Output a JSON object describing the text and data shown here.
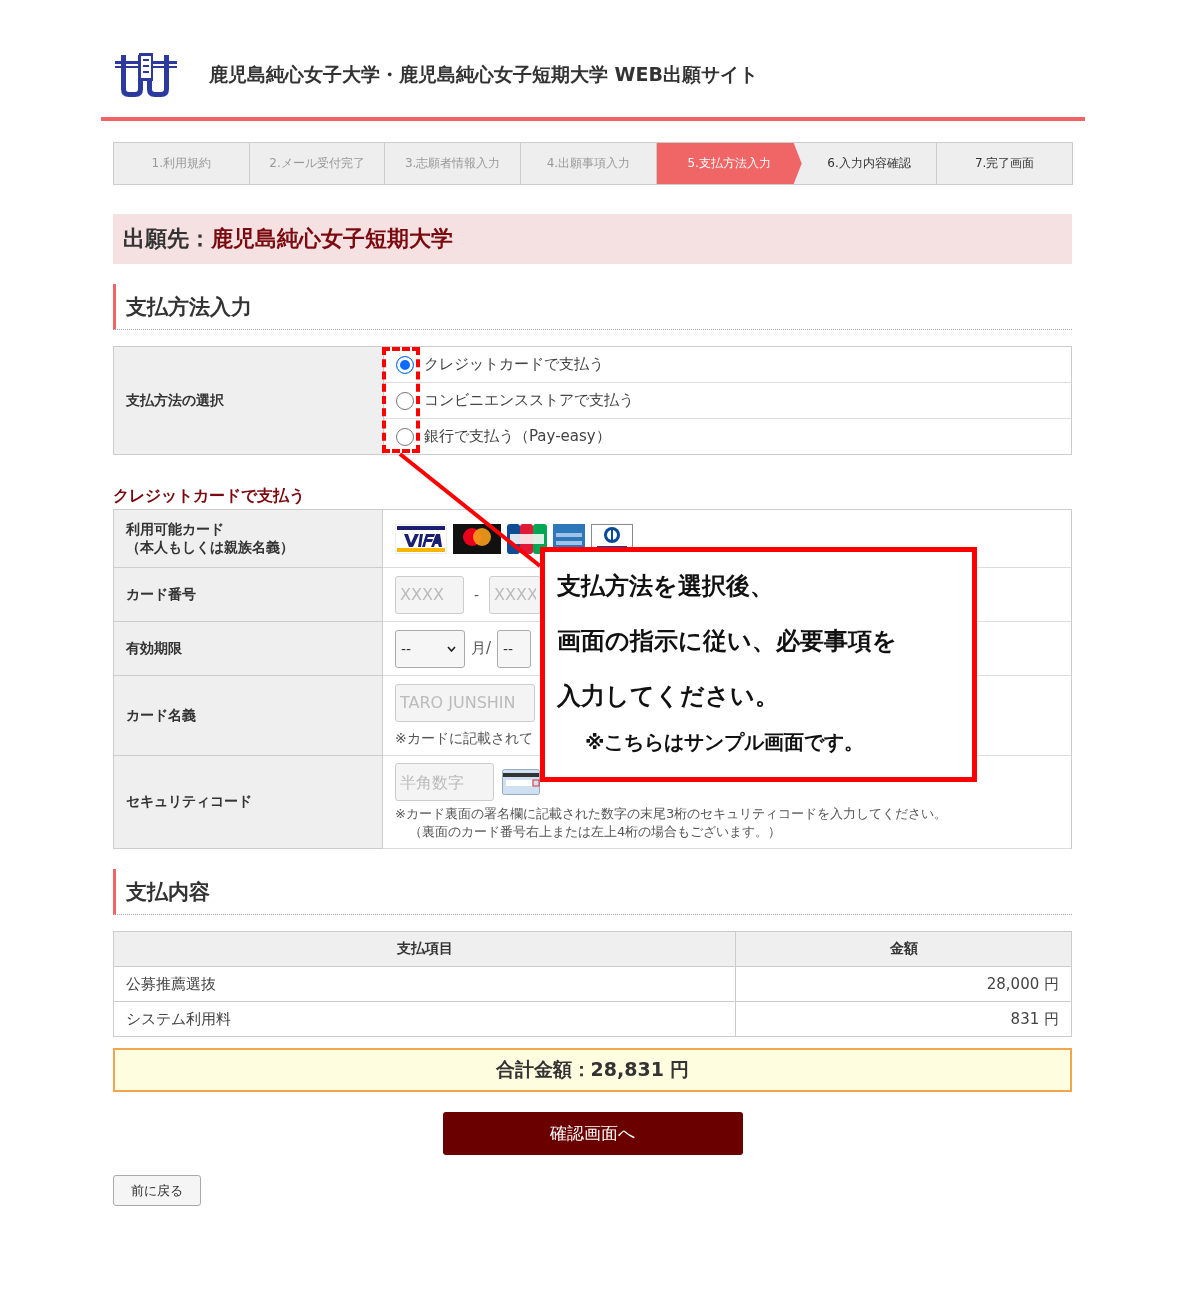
{
  "header": {
    "title": "鹿児島純心女子大学・鹿児島純心女子短期大学 WEB出願サイト"
  },
  "steps": [
    {
      "label": "1.利用規約",
      "selected": false
    },
    {
      "label": "2.メール受付完了",
      "selected": false
    },
    {
      "label": "3.志願者情報入力",
      "selected": false
    },
    {
      "label": "4.出願事項入力",
      "selected": false
    },
    {
      "label": "5.支払方法入力",
      "selected": true
    },
    {
      "label": "6.入力内容確認",
      "selected": false
    },
    {
      "label": "7.完了画面",
      "selected": false
    }
  ],
  "destination": {
    "label": "出願先：",
    "value": "鹿児島純心女子短期大学"
  },
  "payment_method": {
    "heading": "支払方法入力",
    "label": "支払方法の選択",
    "options": [
      {
        "label": "クレジットカードで支払う",
        "selected": true
      },
      {
        "label": "コンビニエンスストアで支払う",
        "selected": false
      },
      {
        "label": "銀行で支払う（Pay-easy）",
        "selected": false
      }
    ]
  },
  "credit_card": {
    "heading": "クレジットカードで支払う",
    "accepted_cards": {
      "label": "利用可能カード",
      "sublabel": "（本人もしくは親族名義）"
    },
    "card_number": {
      "label": "カード番号",
      "fields": [
        {
          "placeholder": "XXXX"
        },
        {
          "placeholder": "XXXX"
        }
      ],
      "separator": "-"
    },
    "expiry": {
      "label": "有効期限",
      "month": "--",
      "month_unit": "月/",
      "year": "--"
    },
    "card_name": {
      "label": "カード名義",
      "placeholder": "TARO JUNSHIN",
      "note": "※カードに記載されて"
    },
    "security_code": {
      "label": "セキュリティコード",
      "placeholder": "半角数字",
      "notes": [
        "※カード裏面の署名欄に記載された数字の末尾3桁のセキュリティコードを入力してください。",
        "（裏面のカード番号右上または左上4桁の場合もございます。）"
      ]
    }
  },
  "summary": {
    "heading": "支払内容",
    "columns": [
      "支払項目",
      "金額"
    ],
    "rows": [
      {
        "item": "公募推薦選抜",
        "amount": "28,000 円"
      },
      {
        "item": "システム利用料",
        "amount": "831 円"
      }
    ],
    "total": "合計金額：28,831 円"
  },
  "buttons": {
    "confirm": "確認画面へ",
    "back": "前に戻る"
  },
  "annotation": {
    "lines": [
      "支払方法を選択後、",
      "画面の指示に従い、必要事項を",
      "入力してください。"
    ],
    "note": "※こちらはサンプル画面です。"
  }
}
